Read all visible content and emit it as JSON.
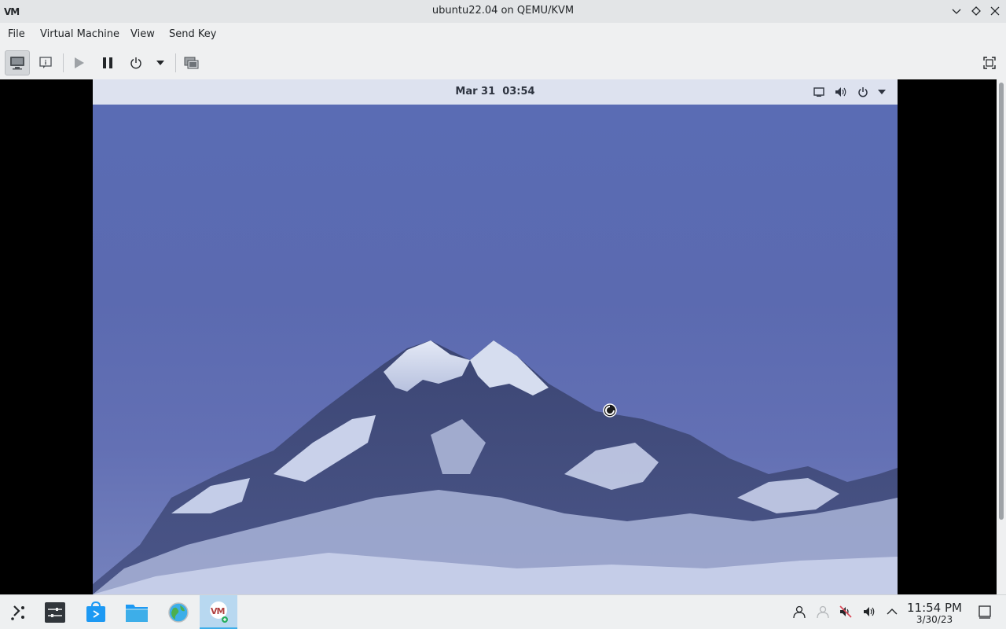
{
  "window": {
    "title": "ubuntu22.04 on QEMU/KVM",
    "logo_text": "VM"
  },
  "menu": {
    "items": [
      "File",
      "Virtual Machine",
      "View",
      "Send Key"
    ]
  },
  "toolbar": {
    "buttons": [
      "console-icon",
      "details-icon",
      "run-icon",
      "pause-icon",
      "shutdown-icon",
      "dropdown-arrow-icon",
      "snapshots-icon",
      "fullscreen-icon"
    ]
  },
  "guest": {
    "date": "Mar 31",
    "time": "03:54",
    "tray_icons": [
      "screen-icon",
      "volume-icon",
      "power-icon",
      "chevron-down-icon"
    ]
  },
  "taskbar": {
    "apps": [
      "application-launcher",
      "system-settings",
      "discover",
      "dolphin-file-manager",
      "web-browser",
      "virt-manager"
    ],
    "active_app": "virt-manager",
    "tray_icons": [
      "user-icon",
      "network-icon",
      "mute-icon",
      "volume-icon",
      "expand-tray-icon"
    ],
    "clock_time": "11:54 PM",
    "clock_date": "3/30/23"
  },
  "colors": {
    "accent": "#3daee9",
    "wallpaper_sky": "#5a6cb4",
    "gnome_bar": "#dde2ef"
  }
}
